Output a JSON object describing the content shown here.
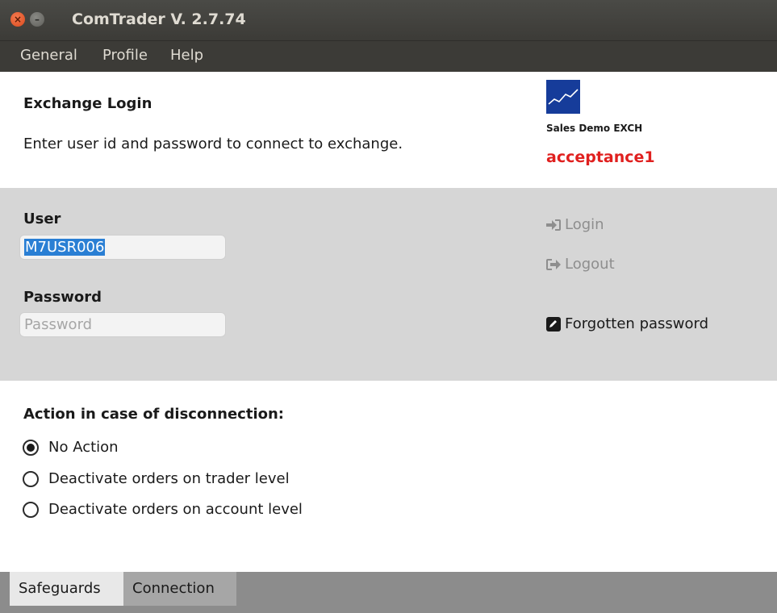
{
  "window": {
    "title": "ComTrader V. 2.7.74"
  },
  "menu": {
    "items": [
      "General",
      "Profile",
      "Help"
    ]
  },
  "header": {
    "title": "Exchange Login",
    "description": "Enter user id and password to connect to exchange.",
    "exchange_name": "Sales Demo EXCH",
    "environment": "acceptance1"
  },
  "login": {
    "user_label": "User",
    "user_value": "M7USR006",
    "password_label": "Password",
    "password_placeholder": "Password",
    "login_button": "Login",
    "logout_button": "Logout",
    "forgot_button": "Forgotten password"
  },
  "disconnection": {
    "title": "Action in case of disconnection:",
    "options": [
      {
        "label": "No Action",
        "checked": true
      },
      {
        "label": "Deactivate orders on trader level",
        "checked": false
      },
      {
        "label": "Deactivate orders on account level",
        "checked": false
      }
    ]
  },
  "tabs": [
    "Safeguards",
    "Connection"
  ],
  "colors": {
    "environment": "#e0201f",
    "selection": "#2a7fd4",
    "logo": "#163c9a"
  }
}
